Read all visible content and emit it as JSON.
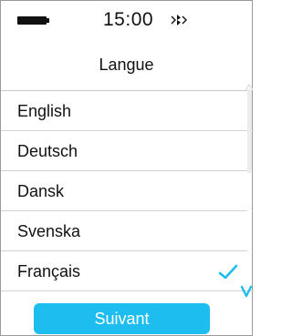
{
  "status_bar": {
    "time": "15:00",
    "battery_icon": "battery-full-icon",
    "connection_icon": "bluetooth-connected-icon"
  },
  "header": {
    "title": "Langue"
  },
  "language_list": {
    "items": [
      {
        "label": "English",
        "selected": false
      },
      {
        "label": "Deutsch",
        "selected": false
      },
      {
        "label": "Dansk",
        "selected": false
      },
      {
        "label": "Svenska",
        "selected": false
      },
      {
        "label": "Français",
        "selected": true
      }
    ],
    "check_icon": "checkmark-icon",
    "scroll_icons": [
      "chevron-up-icon",
      "chevron-down-icon"
    ]
  },
  "footer": {
    "next_label": "Suivant"
  },
  "colors": {
    "accent": "#1dbdf0",
    "text": "#111111",
    "divider": "#d2d2d2"
  }
}
